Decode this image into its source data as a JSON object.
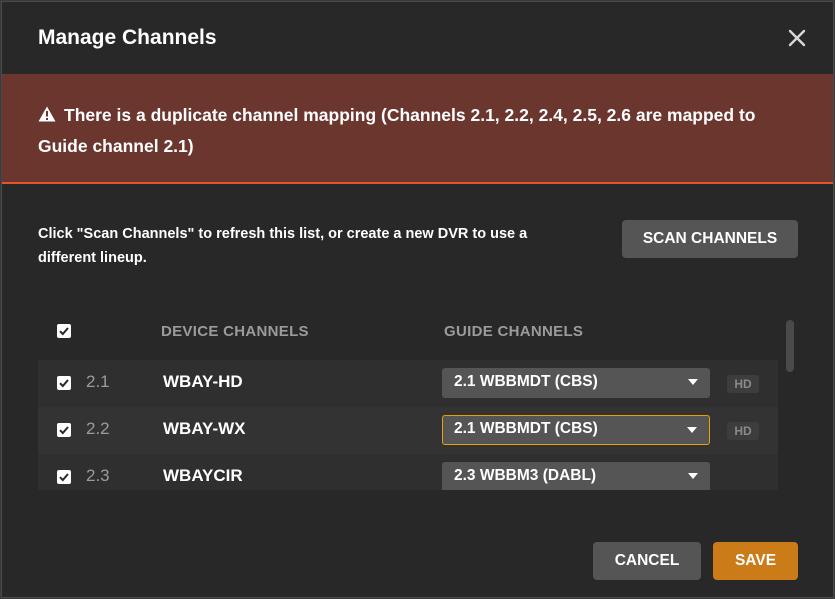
{
  "dialog": {
    "title": "Manage Channels",
    "close_icon": "close-icon"
  },
  "alert": {
    "icon": "warning-icon",
    "message": "There is a duplicate channel mapping (Channels 2.1, 2.2, 2.4, 2.5, 2.6 are mapped to Guide channel 2.1)",
    "background": "#6a362e",
    "accent": "#e5532f"
  },
  "instruction": "Click \"Scan Channels\" to refresh this list, or create a new DVR to use a different lineup.",
  "scan_button": "SCAN CHANNELS",
  "table": {
    "headers": {
      "device": "DEVICE CHANNELS",
      "guide": "GUIDE CHANNELS"
    },
    "select_all_checked": true,
    "rows": [
      {
        "checked": true,
        "number": "2.1",
        "device": "WBAY-HD",
        "guide": "2.1 WBBMDT (CBS)",
        "badge": "HD"
      },
      {
        "checked": true,
        "number": "2.2",
        "device": "WBAY-WX",
        "guide": "2.1 WBBMDT (CBS)",
        "badge": "HD"
      },
      {
        "checked": true,
        "number": "2.3",
        "device": "WBAYCIR",
        "guide": "2.3 WBBM3 (DABL)",
        "badge": ""
      }
    ]
  },
  "footer": {
    "cancel": "CANCEL",
    "save": "SAVE",
    "save_color": "#cc7b19"
  }
}
